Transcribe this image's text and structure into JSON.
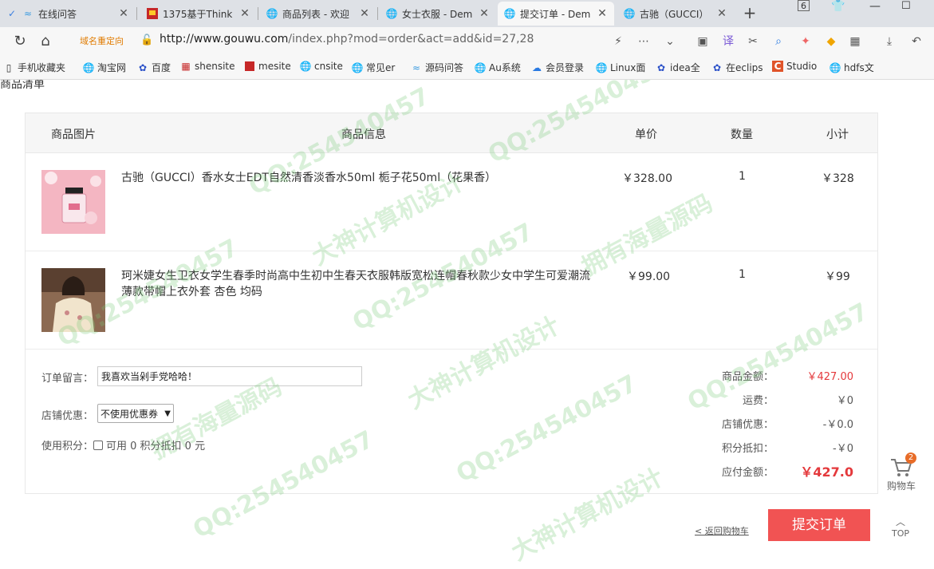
{
  "browser": {
    "tabs": [
      {
        "label": "在线问答",
        "icon": "question-icon"
      },
      {
        "label": "1375基于Think",
        "icon": "red-flag-icon"
      },
      {
        "label": "商品列表 - 欢迎",
        "icon": "globe-icon"
      },
      {
        "label": "女士衣服 - Dem",
        "icon": "globe-icon"
      },
      {
        "label": "提交订单 - Dem",
        "icon": "globe-icon"
      },
      {
        "label": "古驰（GUCCI）",
        "icon": "globe-icon"
      }
    ],
    "window_badge": "6",
    "redirect_label": "域名重定向",
    "url_host": "http://www.gouwu.com",
    "url_path": "/index.php?mod=order&act=add&id=27,28",
    "bookmarks": [
      "手机收藏夹",
      "淘宝网",
      "百度",
      "shensite",
      "mesite",
      "cnsite",
      "常见er",
      "源码问答",
      "Au系统",
      "会员登录",
      "Linux面",
      "idea全",
      "在eclips",
      "Studio",
      "hdfs文"
    ]
  },
  "page": {
    "section_title": "商品清单",
    "table_headers": {
      "image": "商品图片",
      "info": "商品信息",
      "price": "单价",
      "qty": "数量",
      "subtotal": "小计"
    },
    "items": [
      {
        "name": "古驰（GUCCI）香水女士EDT自然清香淡香水50ml 栀子花50ml（花果香）",
        "price": "￥328.00",
        "qty": "1",
        "subtotal": "￥328"
      },
      {
        "name": "珂米婕女生卫衣女学生春季时尚高中生初中生春天衣服韩版宽松连帽春秋款少女中学生可爱潮流薄款带帽上衣外套 杏色 均码",
        "price": "￥99.00",
        "qty": "1",
        "subtotal": "￥99"
      }
    ],
    "message_label": "订单留言：",
    "message_value": "我喜欢当剁手党哈哈！",
    "coupon_label": "店铺优惠：",
    "coupon_value": "不使用优惠券",
    "points_label": "使用积分：",
    "points_text": "可用 0 积分抵扣 0 元",
    "summary": [
      {
        "label": "商品金额：",
        "value": "￥427.00"
      },
      {
        "label": "运费：",
        "value": "￥0"
      },
      {
        "label": "店铺优惠：",
        "value": "-￥0.0"
      },
      {
        "label": "积分抵扣：",
        "value": "-￥0"
      },
      {
        "label": "应付金额：",
        "value": "￥427.0"
      }
    ],
    "back_link": "< 返回购物车",
    "submit_label": "提交订单",
    "side_cart_label": "购物车",
    "side_cart_count": "2",
    "side_top_label": "TOP",
    "watermarks": [
      "QQ:254540457",
      "大神计算机设计",
      "拥有海量源码"
    ]
  },
  "colors": {
    "accent": "#f15353",
    "price_red": "#e4393c",
    "badge": "#e86c28"
  }
}
